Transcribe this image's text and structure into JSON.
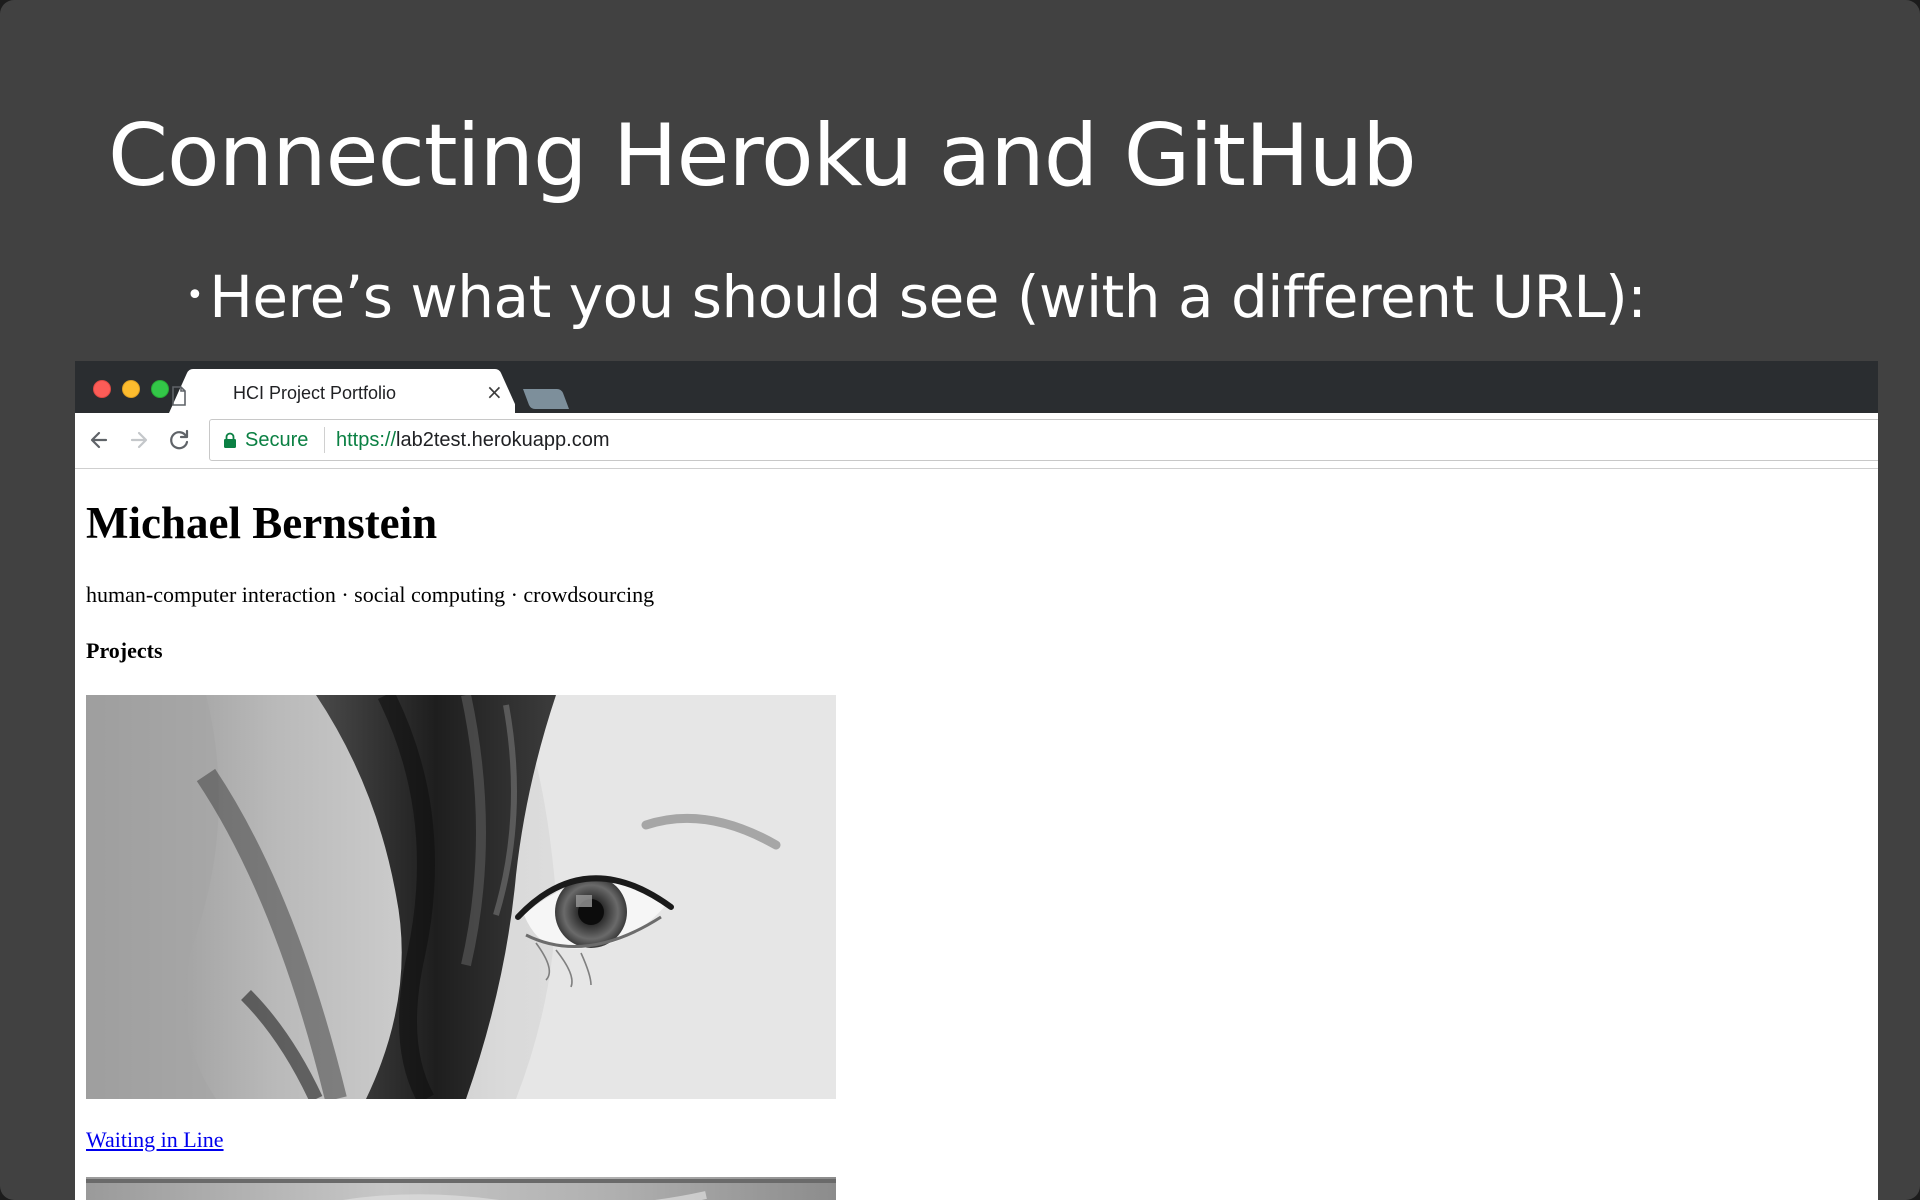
{
  "slide": {
    "title": "Connecting Heroku and GitHub",
    "bullet": "Here’s what you should see (with a different URL):",
    "bullet_marker": "•"
  },
  "browser": {
    "tab": {
      "title": "HCI Project Portfolio",
      "close_glyph": "×",
      "icon": "page-icon"
    },
    "toolbar": {
      "back_icon": "arrow-left-icon",
      "forward_icon": "arrow-right-icon",
      "reload_icon": "reload-icon"
    },
    "address": {
      "security_icon": "lock-icon",
      "security_label": "Secure",
      "url_scheme": "https://",
      "url_host": "lab2test.herokuapp.com"
    },
    "traffic_lights": {
      "close": "#fc5c57",
      "minimize": "#fdbc2e",
      "maximize": "#33c748"
    }
  },
  "page": {
    "name": "Michael Bernstein",
    "tagline": "human-computer interaction · social computing · crowdsourcing",
    "section_heading": "Projects",
    "projects": [
      {
        "link_text": "Waiting in Line"
      }
    ]
  },
  "colors": {
    "slide_background": "#414141",
    "tabbar_background": "#2a2d30",
    "secure_green": "#0b8043",
    "link_blue": "#0000ee"
  }
}
